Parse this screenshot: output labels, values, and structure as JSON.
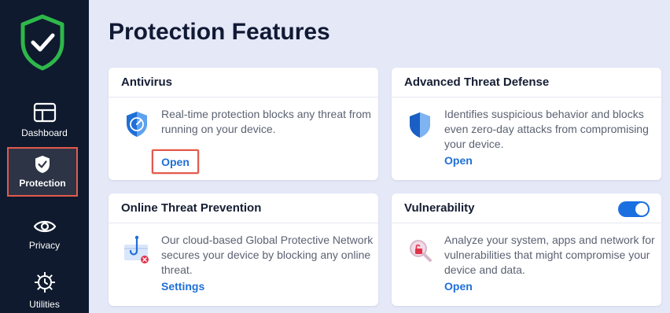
{
  "sidebar": {
    "items": [
      {
        "label": "Dashboard",
        "icon": "dashboard-icon"
      },
      {
        "label": "Protection",
        "icon": "shield-check-icon",
        "active": true
      },
      {
        "label": "Privacy",
        "icon": "eye-icon"
      },
      {
        "label": "Utilities",
        "icon": "gear-icon"
      }
    ]
  },
  "page": {
    "title": "Protection Features"
  },
  "cards": {
    "antivirus": {
      "title": "Antivirus",
      "description": "Real-time protection blocks any threat from running on your device.",
      "action": "Open",
      "icon": "antivirus-shield-icon"
    },
    "atd": {
      "title": "Advanced Threat Defense",
      "description": "Identifies suspicious behavior and blocks even zero-day attacks from compromising your device.",
      "action": "Open",
      "icon": "threat-defense-shield-icon"
    },
    "otp": {
      "title": "Online Threat Prevention",
      "description": "Our cloud-based Global Protective Network secures your device by blocking any online threat.",
      "action": "Settings",
      "icon": "web-hook-icon"
    },
    "vulnerability": {
      "title": "Vulnerability",
      "description": "Analyze your system, apps and network for vulnerabilities that might compromise your device and data.",
      "action": "Open",
      "icon": "magnifier-lock-icon",
      "toggle_on": true
    }
  },
  "colors": {
    "sidebar_bg": "#0f1a2e",
    "page_bg": "#e4e8f7",
    "accent_blue": "#1f6fd6",
    "brand_green": "#2eb84a",
    "highlight_red": "#e25a4c"
  }
}
